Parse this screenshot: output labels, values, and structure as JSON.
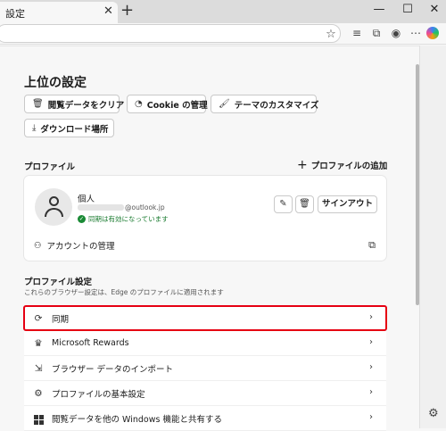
{
  "browser": {
    "tab_title": "設定",
    "tab_close": "✕",
    "new_tab": "+",
    "window_controls": {
      "minimize": "—",
      "maximize": "☐",
      "close": "✕"
    },
    "toolbar_icons": [
      "star-icon",
      "favorites-icon",
      "collections-icon",
      "profile-icon",
      "more-icon",
      "copilot-icon"
    ]
  },
  "page": {
    "title": "上位の設定",
    "quick_actions": [
      {
        "label": "閲覧データをクリア",
        "icon": "trash-icon"
      },
      {
        "label": "Cookie の管理",
        "icon": "cookie-icon"
      },
      {
        "label": "テーマのカスタマイズ",
        "icon": "brush-icon"
      },
      {
        "label": "ダウンロード場所",
        "icon": "download-icon"
      }
    ],
    "profile_section_title": "プロファイル",
    "add_profile": "プロファイルの追加",
    "profile": {
      "name": "個人",
      "email_suffix": "@outlook.jp",
      "sync_status": "同期は有効になっています",
      "signout": "サインアウト",
      "manage_account": "アカウントの管理"
    },
    "profile_settings_title": "プロファイル設定",
    "profile_settings_subtitle": "これらのブラウザー設定は、Edge のプロファイルに適用されます",
    "settings_rows": [
      {
        "label": "同期",
        "icon": "sync-icon"
      },
      {
        "label": "Microsoft Rewards",
        "icon": "trophy-icon"
      },
      {
        "label": "ブラウザー データのインポート",
        "icon": "import-icon"
      },
      {
        "label": "プロファイルの基本設定",
        "icon": "people-settings-icon"
      },
      {
        "label": "閲覧データを他の Windows 機能と共有する",
        "icon": "windows-icon"
      }
    ]
  }
}
